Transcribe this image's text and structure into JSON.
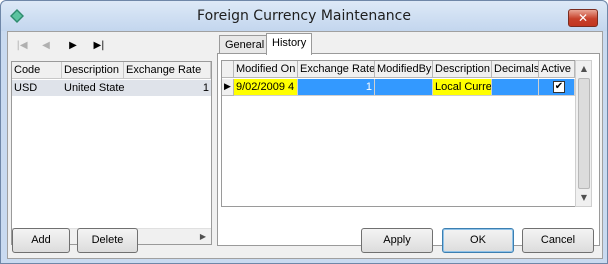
{
  "window": {
    "title": "Foreign Currency Maintenance",
    "close_label": "✕"
  },
  "nav": {
    "icons": [
      "first-record-icon",
      "previous-record-icon",
      "next-record-icon",
      "last-record-icon"
    ],
    "glyphs": [
      "|◀",
      "◀",
      "▶",
      "▶|"
    ]
  },
  "currency_list": {
    "columns": [
      "Code",
      "Description",
      "Exchange Rate"
    ],
    "rows": [
      {
        "code": "USD",
        "description": "United States",
        "exchange_rate": "1"
      }
    ]
  },
  "tabs": [
    {
      "label": "General",
      "active": false
    },
    {
      "label": "History",
      "active": true
    }
  ],
  "history_grid": {
    "columns": [
      "Modified On",
      "Exchange Rate",
      "ModifiedBy",
      "Description",
      "Decimals",
      "Active"
    ],
    "rows": [
      {
        "modified_on": "9/02/2009 4",
        "exchange_rate": "1",
        "modified_by": "",
        "description": "Local Currer",
        "decimals": "",
        "active": true
      }
    ]
  },
  "buttons": {
    "add": "Add",
    "delete": "Delete",
    "apply": "Apply",
    "ok": "OK",
    "cancel": "Cancel"
  },
  "colors": {
    "title_bar": "#c9daf0",
    "highlight_yellow": "#ffff00",
    "highlight_blue": "#3399ff",
    "close_red": "#c7402a"
  }
}
